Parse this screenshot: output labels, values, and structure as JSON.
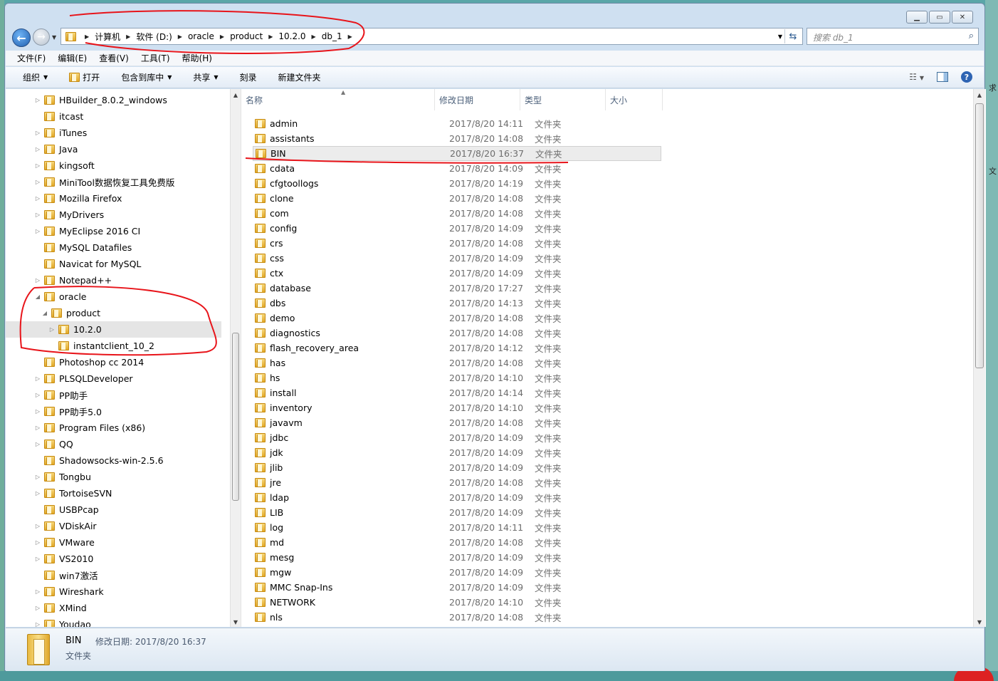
{
  "address": {
    "crumbs": [
      "计算机",
      "软件 (D:)",
      "oracle",
      "product",
      "10.2.0",
      "db_1"
    ]
  },
  "search": {
    "placeholder": "搜索 db_1"
  },
  "menu": [
    "文件(F)",
    "编辑(E)",
    "查看(V)",
    "工具(T)",
    "帮助(H)"
  ],
  "toolbar": {
    "organize": "组织",
    "open": "打开",
    "include": "包含到库中",
    "share": "共享",
    "burn": "刻录",
    "new_folder": "新建文件夹"
  },
  "tree": [
    {
      "label": "HBuilder_8.0.2_windows",
      "arrow": "▷",
      "indent": 0
    },
    {
      "label": "itcast",
      "arrow": "",
      "indent": 0
    },
    {
      "label": "iTunes",
      "arrow": "▷",
      "indent": 0
    },
    {
      "label": "Java",
      "arrow": "▷",
      "indent": 0
    },
    {
      "label": "kingsoft",
      "arrow": "▷",
      "indent": 0
    },
    {
      "label": "MiniTool数据恢复工具免费版",
      "arrow": "▷",
      "indent": 0
    },
    {
      "label": "Mozilla Firefox",
      "arrow": "▷",
      "indent": 0
    },
    {
      "label": "MyDrivers",
      "arrow": "▷",
      "indent": 0
    },
    {
      "label": "MyEclipse 2016 CI",
      "arrow": "▷",
      "indent": 0
    },
    {
      "label": "MySQL Datafiles",
      "arrow": "",
      "indent": 0
    },
    {
      "label": "Navicat for MySQL",
      "arrow": "",
      "indent": 0
    },
    {
      "label": "Notepad++",
      "arrow": "▷",
      "indent": 0
    },
    {
      "label": "oracle",
      "arrow": "◢",
      "indent": 0
    },
    {
      "label": "product",
      "arrow": "◢",
      "indent": 1
    },
    {
      "label": "10.2.0",
      "arrow": "▷",
      "indent": 2,
      "selected": true
    },
    {
      "label": "instantclient_10_2",
      "arrow": "",
      "indent": 2
    },
    {
      "label": "Photoshop cc 2014",
      "arrow": "",
      "indent": 0
    },
    {
      "label": "PLSQLDeveloper",
      "arrow": "▷",
      "indent": 0
    },
    {
      "label": "PP助手",
      "arrow": "▷",
      "indent": 0
    },
    {
      "label": "PP助手5.0",
      "arrow": "▷",
      "indent": 0
    },
    {
      "label": "Program Files (x86)",
      "arrow": "▷",
      "indent": 0
    },
    {
      "label": "QQ",
      "arrow": "▷",
      "indent": 0
    },
    {
      "label": "Shadowsocks-win-2.5.6",
      "arrow": "",
      "indent": 0
    },
    {
      "label": "Tongbu",
      "arrow": "▷",
      "indent": 0
    },
    {
      "label": "TortoiseSVN",
      "arrow": "▷",
      "indent": 0
    },
    {
      "label": "USBPcap",
      "arrow": "",
      "indent": 0
    },
    {
      "label": "VDiskAir",
      "arrow": "▷",
      "indent": 0
    },
    {
      "label": "VMware",
      "arrow": "▷",
      "indent": 0
    },
    {
      "label": "VS2010",
      "arrow": "▷",
      "indent": 0
    },
    {
      "label": "win7激活",
      "arrow": "",
      "indent": 0
    },
    {
      "label": "Wireshark",
      "arrow": "▷",
      "indent": 0
    },
    {
      "label": "XMind",
      "arrow": "▷",
      "indent": 0
    },
    {
      "label": "Youdao",
      "arrow": "▷",
      "indent": 0
    }
  ],
  "columns": {
    "name": "名称",
    "modified": "修改日期",
    "type": "类型",
    "size": "大小"
  },
  "files": [
    {
      "name": "admin",
      "date": "2017/8/20 14:11",
      "type": "文件夹"
    },
    {
      "name": "assistants",
      "date": "2017/8/20 14:08",
      "type": "文件夹"
    },
    {
      "name": "BIN",
      "date": "2017/8/20 16:37",
      "type": "文件夹",
      "selected": true
    },
    {
      "name": "cdata",
      "date": "2017/8/20 14:09",
      "type": "文件夹"
    },
    {
      "name": "cfgtoollogs",
      "date": "2017/8/20 14:19",
      "type": "文件夹"
    },
    {
      "name": "clone",
      "date": "2017/8/20 14:08",
      "type": "文件夹"
    },
    {
      "name": "com",
      "date": "2017/8/20 14:08",
      "type": "文件夹"
    },
    {
      "name": "config",
      "date": "2017/8/20 14:09",
      "type": "文件夹"
    },
    {
      "name": "crs",
      "date": "2017/8/20 14:08",
      "type": "文件夹"
    },
    {
      "name": "css",
      "date": "2017/8/20 14:09",
      "type": "文件夹"
    },
    {
      "name": "ctx",
      "date": "2017/8/20 14:09",
      "type": "文件夹"
    },
    {
      "name": "database",
      "date": "2017/8/20 17:27",
      "type": "文件夹"
    },
    {
      "name": "dbs",
      "date": "2017/8/20 14:13",
      "type": "文件夹"
    },
    {
      "name": "demo",
      "date": "2017/8/20 14:08",
      "type": "文件夹"
    },
    {
      "name": "diagnostics",
      "date": "2017/8/20 14:08",
      "type": "文件夹"
    },
    {
      "name": "flash_recovery_area",
      "date": "2017/8/20 14:12",
      "type": "文件夹"
    },
    {
      "name": "has",
      "date": "2017/8/20 14:08",
      "type": "文件夹"
    },
    {
      "name": "hs",
      "date": "2017/8/20 14:10",
      "type": "文件夹"
    },
    {
      "name": "install",
      "date": "2017/8/20 14:14",
      "type": "文件夹"
    },
    {
      "name": "inventory",
      "date": "2017/8/20 14:10",
      "type": "文件夹"
    },
    {
      "name": "javavm",
      "date": "2017/8/20 14:08",
      "type": "文件夹"
    },
    {
      "name": "jdbc",
      "date": "2017/8/20 14:09",
      "type": "文件夹"
    },
    {
      "name": "jdk",
      "date": "2017/8/20 14:09",
      "type": "文件夹"
    },
    {
      "name": "jlib",
      "date": "2017/8/20 14:09",
      "type": "文件夹"
    },
    {
      "name": "jre",
      "date": "2017/8/20 14:08",
      "type": "文件夹"
    },
    {
      "name": "ldap",
      "date": "2017/8/20 14:09",
      "type": "文件夹"
    },
    {
      "name": "LIB",
      "date": "2017/8/20 14:09",
      "type": "文件夹"
    },
    {
      "name": "log",
      "date": "2017/8/20 14:11",
      "type": "文件夹"
    },
    {
      "name": "md",
      "date": "2017/8/20 14:08",
      "type": "文件夹"
    },
    {
      "name": "mesg",
      "date": "2017/8/20 14:09",
      "type": "文件夹"
    },
    {
      "name": "mgw",
      "date": "2017/8/20 14:09",
      "type": "文件夹"
    },
    {
      "name": "MMC Snap-Ins",
      "date": "2017/8/20 14:09",
      "type": "文件夹"
    },
    {
      "name": "NETWORK",
      "date": "2017/8/20 14:10",
      "type": "文件夹"
    },
    {
      "name": "nls",
      "date": "2017/8/20 14:08",
      "type": "文件夹"
    }
  ],
  "details": {
    "name": "BIN",
    "modified_label": "修改日期: 2017/8/20 16:37",
    "type": "文件夹"
  },
  "desktop_edge_text": [
    "求",
    "文"
  ],
  "colors": {
    "annotation_ink": "#e8141a",
    "selection": "#e5e5e5"
  }
}
